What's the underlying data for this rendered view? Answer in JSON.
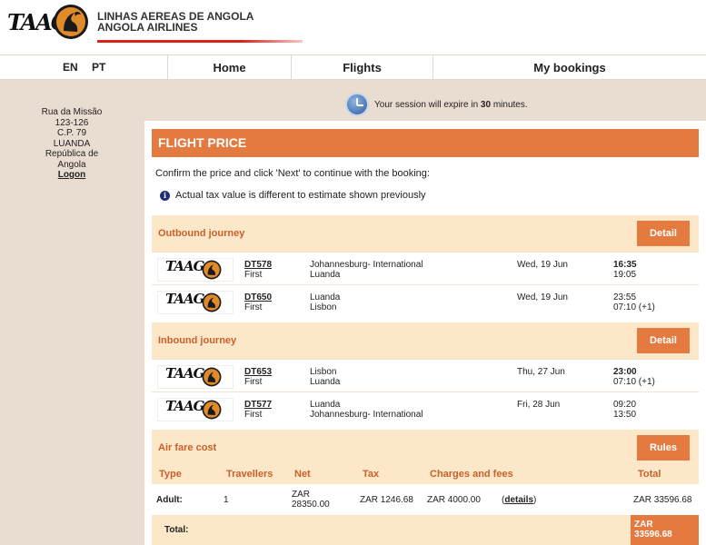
{
  "header": {
    "logo_text": "TAAG",
    "airline_name_line1": "LINHAS AEREAS DE ANGOLA",
    "airline_name_line2": "ANGOLA AIRLINES"
  },
  "nav": {
    "lang_en": "EN",
    "lang_pt": "PT",
    "home": "Home",
    "flights": "Flights",
    "my_bookings": "My bookings"
  },
  "sidebar": {
    "address": [
      "Rua da Missão",
      "123-126",
      "C.P. 79",
      "LUANDA",
      "República de",
      "Angola"
    ],
    "logon": "Logon"
  },
  "session": {
    "prefix": "Your session will expire in ",
    "minutes": "30",
    "suffix": " minutes."
  },
  "page": {
    "title": "FLIGHT PRICE",
    "instruction": "Confirm the price and click 'Next' to continue with the booking:",
    "note": "Actual tax value is different to estimate shown previously"
  },
  "outbound": {
    "title": "Outbound journey",
    "detail_label": "Detail",
    "flights": [
      {
        "number": "DT578",
        "class": "First",
        "from": "Johannesburg- International",
        "to": "Luanda",
        "date": "Wed, 19 Jun",
        "dep": "16:35",
        "arr": "19:05"
      },
      {
        "number": "DT650",
        "class": "First",
        "from": "Luanda",
        "to": "Lisbon",
        "date": "Wed, 19 Jun",
        "dep": "23:55",
        "arr": "07:10 (+1)"
      }
    ]
  },
  "inbound": {
    "title": "Inbound journey",
    "detail_label": "Detail",
    "flights": [
      {
        "number": "DT653",
        "class": "First",
        "from": "Lisbon",
        "to": "Luanda",
        "date": "Thu, 27 Jun",
        "dep": "23:00",
        "arr": "07:10 (+1)"
      },
      {
        "number": "DT577",
        "class": "First",
        "from": "Luanda",
        "to": "Johannesburg- International",
        "date": "Fri, 28 Jun",
        "dep": "09:20",
        "arr": "13:50"
      }
    ]
  },
  "fare": {
    "title": "Air fare cost",
    "rules_label": "Rules",
    "columns": [
      "Type",
      "Travellers",
      "Net",
      "Tax",
      "Charges and fees",
      "Total"
    ],
    "row": {
      "type": "Adult:",
      "travellers": "1",
      "net_currency": "ZAR",
      "net_value": "28350.00",
      "tax": "ZAR 1246.68",
      "charges": "ZAR 4000.00",
      "details_open": "(",
      "details_link": "details",
      "details_close": ")",
      "total": "ZAR 33596.68"
    },
    "total_label": "Total:",
    "total_currency": "ZAR",
    "total_value": "33596.68"
  },
  "colors": {
    "accent": "#e57a40",
    "section_bg": "#fde7c9",
    "section_title": "#c7612a",
    "page_bg": "#e9ddd2"
  }
}
